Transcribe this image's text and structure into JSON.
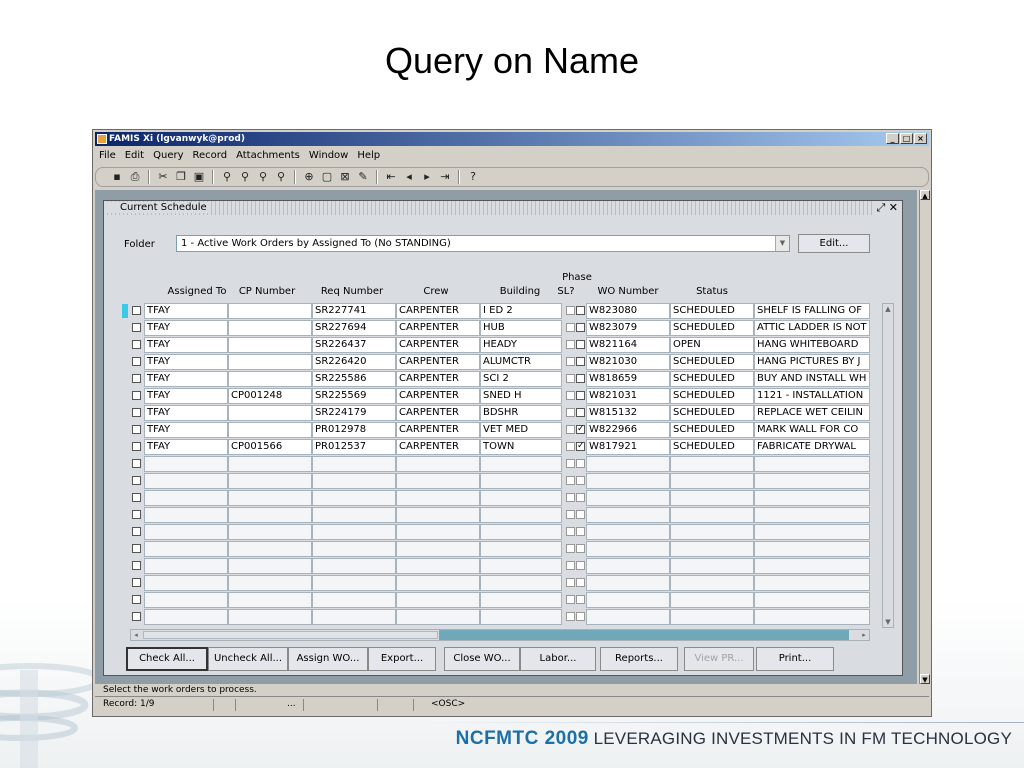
{
  "slide": {
    "title": "Query on Name",
    "footer_brand": "NCFMTC 2009",
    "footer_tagline": "LEVERAGING INVESTMENTS IN FM TECHNOLOGY"
  },
  "window": {
    "title": "FAMIS Xi (lgvanwyk@prod)",
    "controls": [
      "_",
      "□",
      "×"
    ]
  },
  "menu": [
    "File",
    "Edit",
    "Query",
    "Record",
    "Attachments",
    "Window",
    "Help"
  ],
  "toolbar_icons": [
    "save-icon",
    "print-icon",
    "cut-icon",
    "copy-icon",
    "paste-icon",
    "enter-query-icon",
    "execute-query-icon",
    "cancel-query-icon",
    "count-query-icon",
    "insert-record-icon",
    "duplicate-record-icon",
    "delete-record-icon",
    "edit-icon",
    "first-record-icon",
    "previous-record-icon",
    "next-record-icon",
    "last-record-icon",
    "help-icon"
  ],
  "form": {
    "title": "Current Schedule",
    "folder_label": "Folder",
    "folder_value": "1 - Active Work Orders by Assigned To  (No STANDING)",
    "edit_button": "Edit...",
    "columns": {
      "assigned_to": "Assigned To",
      "cp_number": "CP Number",
      "req_number": "Req Number",
      "crew": "Crew",
      "building": "Building",
      "phase_top": "Phase",
      "phase_sl": "SL?",
      "wo_number": "WO Number",
      "status": "Status"
    },
    "rows": [
      {
        "assigned_to": "TFAY",
        "cp_number": "",
        "req_number": "SR227741",
        "crew": "CARPENTER",
        "building": "I ED 2",
        "phase": false,
        "wo_number": "W823080",
        "status": "SCHEDULED",
        "description": "SHELF IS FALLING OF"
      },
      {
        "assigned_to": "TFAY",
        "cp_number": "",
        "req_number": "SR227694",
        "crew": "CARPENTER",
        "building": "HUB",
        "phase": false,
        "wo_number": "W823079",
        "status": "SCHEDULED",
        "description": "ATTIC LADDER IS NOT"
      },
      {
        "assigned_to": "TFAY",
        "cp_number": "",
        "req_number": "SR226437",
        "crew": "CARPENTER",
        "building": "HEADY",
        "phase": false,
        "wo_number": "W821164",
        "status": "OPEN",
        "description": "HANG WHITEBOARD"
      },
      {
        "assigned_to": "TFAY",
        "cp_number": "",
        "req_number": "SR226420",
        "crew": "CARPENTER",
        "building": "ALUMCTR",
        "phase": false,
        "wo_number": "W821030",
        "status": "SCHEDULED",
        "description": "HANG PICTURES BY J"
      },
      {
        "assigned_to": "TFAY",
        "cp_number": "",
        "req_number": "SR225586",
        "crew": "CARPENTER",
        "building": "SCI 2",
        "phase": false,
        "wo_number": "W818659",
        "status": "SCHEDULED",
        "description": "BUY AND INSTALL WH"
      },
      {
        "assigned_to": "TFAY",
        "cp_number": "CP001248",
        "req_number": "SR225569",
        "crew": "CARPENTER",
        "building": "SNED H",
        "phase": false,
        "wo_number": "W821031",
        "status": "SCHEDULED",
        "description": "1121 - INSTALLATION"
      },
      {
        "assigned_to": "TFAY",
        "cp_number": "",
        "req_number": "SR224179",
        "crew": "CARPENTER",
        "building": "BDSHR",
        "phase": false,
        "wo_number": "W815132",
        "status": "SCHEDULED",
        "description": "REPLACE WET CEILIN"
      },
      {
        "assigned_to": "TFAY",
        "cp_number": "",
        "req_number": "PR012978",
        "crew": "CARPENTER",
        "building": "VET MED",
        "phase": true,
        "wo_number": "W822966",
        "status": "SCHEDULED",
        "description": "MARK WALL FOR CO"
      },
      {
        "assigned_to": "TFAY",
        "cp_number": "CP001566",
        "req_number": "PR012537",
        "crew": "CARPENTER",
        "building": "TOWN",
        "phase": true,
        "wo_number": "W817921",
        "status": "SCHEDULED",
        "description": "FABRICATE DRYWAL"
      }
    ],
    "empty_rows": 10,
    "buttons": [
      {
        "key": "check_all",
        "label": "Check All...",
        "disabled": false
      },
      {
        "key": "uncheck_all",
        "label": "Uncheck All...",
        "disabled": false
      },
      {
        "key": "assign_wo",
        "label": "Assign WO...",
        "disabled": false
      },
      {
        "key": "export",
        "label": "Export...",
        "disabled": false
      },
      {
        "key": "close_wo",
        "label": "Close WO...",
        "disabled": false
      },
      {
        "key": "labor",
        "label": "Labor...",
        "disabled": false
      },
      {
        "key": "reports",
        "label": "Reports...",
        "disabled": false
      },
      {
        "key": "view_pr",
        "label": "View PR...",
        "disabled": true
      },
      {
        "key": "print",
        "label": "Print...",
        "disabled": false
      }
    ]
  },
  "status": {
    "message": "Select the work orders to process.",
    "record": "Record: 1/9",
    "dots": "...",
    "osc": "<OSC>"
  },
  "colors": {
    "titlebar": "#0a246a",
    "current_row_indicator": "#3cc9e8",
    "brand_blue": "#1c6fa8"
  }
}
